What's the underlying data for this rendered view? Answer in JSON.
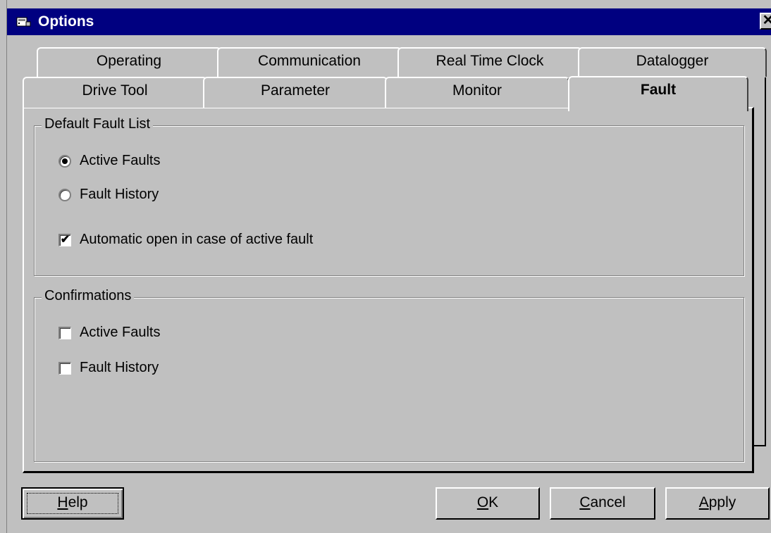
{
  "window": {
    "title": "Options",
    "close_glyph": "✕"
  },
  "tabs": {
    "back_row": [
      "Operating",
      "Communication",
      "Real Time Clock",
      "Datalogger"
    ],
    "front_row": [
      "Drive Tool",
      "Parameter",
      "Monitor",
      "Fault"
    ],
    "active": "Fault"
  },
  "default_fault_list": {
    "label": "Default Fault List",
    "radio_active": "Active Faults",
    "radio_history": "Fault History",
    "selected": "Active Faults",
    "auto_open_label": "Automatic open in case of active fault",
    "auto_open_checked": true
  },
  "confirmations": {
    "label": "Confirmations",
    "active_faults": "Active Faults",
    "fault_history": "Fault History",
    "active_checked": false,
    "history_checked": false
  },
  "buttons": {
    "help": {
      "mnemonic": "H",
      "rest": "elp"
    },
    "ok": {
      "mnemonic": "O",
      "rest": "K"
    },
    "cancel": {
      "mnemonic": "C",
      "rest": "ancel"
    },
    "apply": {
      "mnemonic": "A",
      "rest": "pply"
    }
  },
  "icons": {
    "title": "app-icon",
    "close": "close-icon"
  }
}
